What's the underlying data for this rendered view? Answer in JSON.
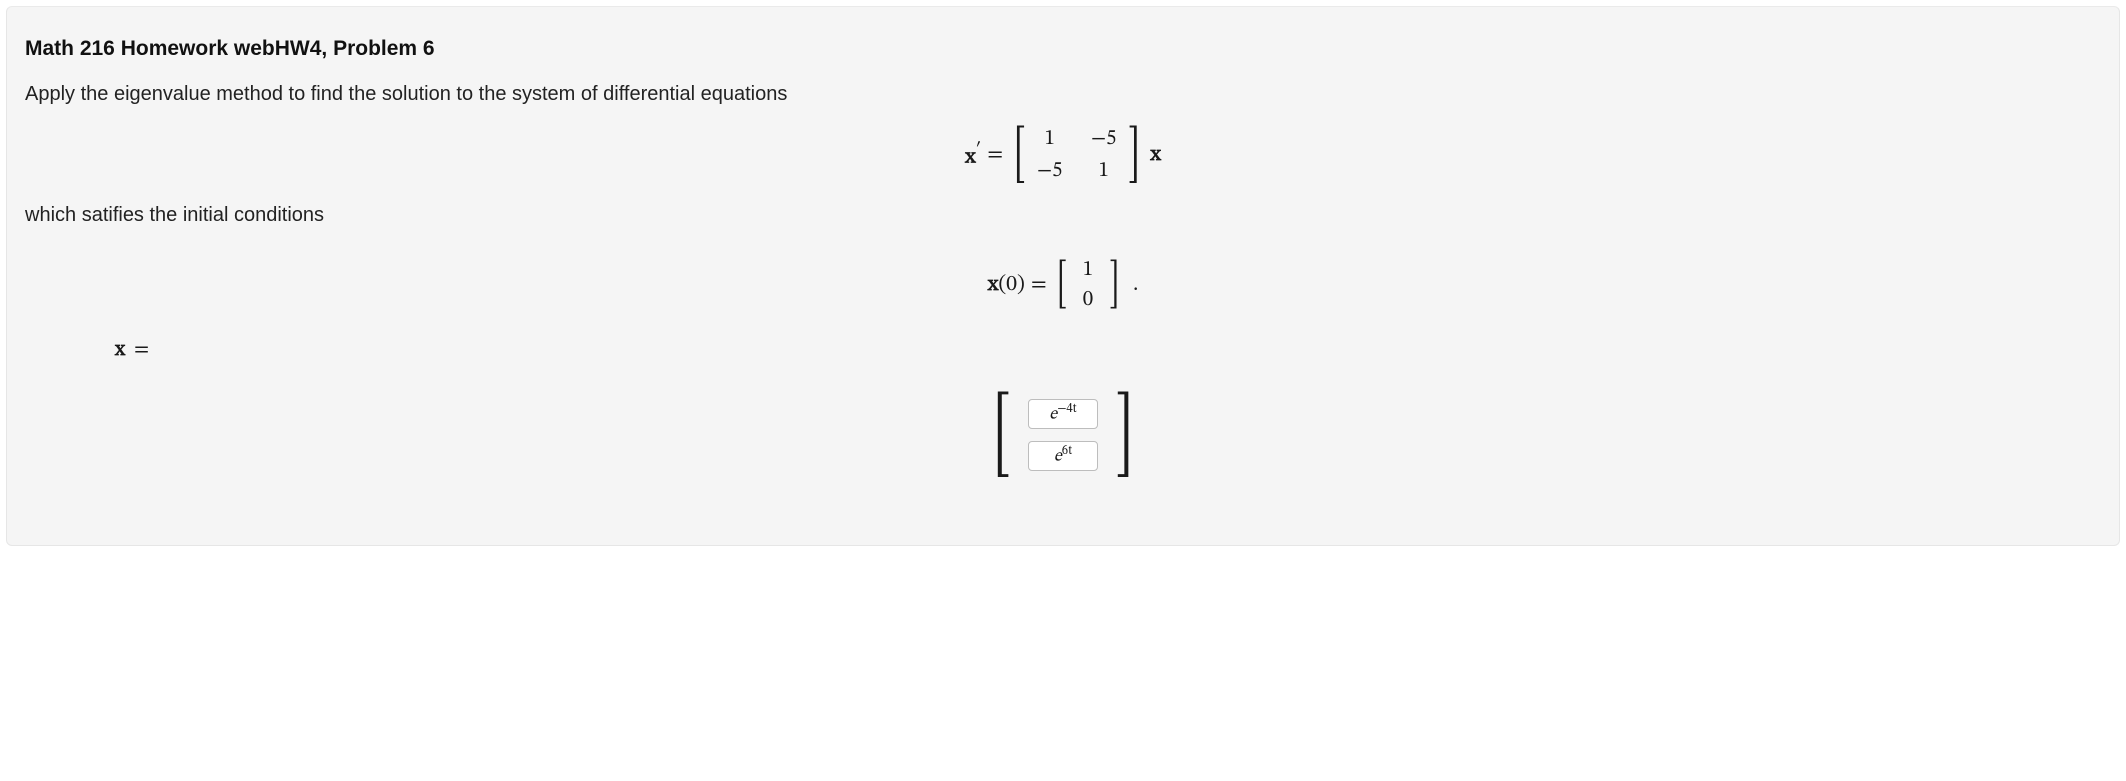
{
  "header": {
    "title": "Math 216 Homework webHW4, Problem 6"
  },
  "body": {
    "intro": "Apply the eigenvalue method to find the solution to the system of differential equations",
    "between": "which satifies the initial conditions"
  },
  "equation1": {
    "lhs_var": "x",
    "lhs_prime": "′",
    "equals": "=",
    "matrix": {
      "a11": "1",
      "a12": "−5",
      "a21": "−5",
      "a22": "1"
    },
    "rhs_var": "x"
  },
  "equation2": {
    "lhs_var": "x",
    "lhs_arg": "(0)",
    "equals": "=",
    "vector": {
      "r1": "1",
      "r2": "0"
    },
    "period": "."
  },
  "answer": {
    "label_var": "x",
    "label_eq": "=",
    "input1_base": "e",
    "input1_exp": "−4t",
    "input2_base": "e",
    "input2_exp": "6t"
  }
}
